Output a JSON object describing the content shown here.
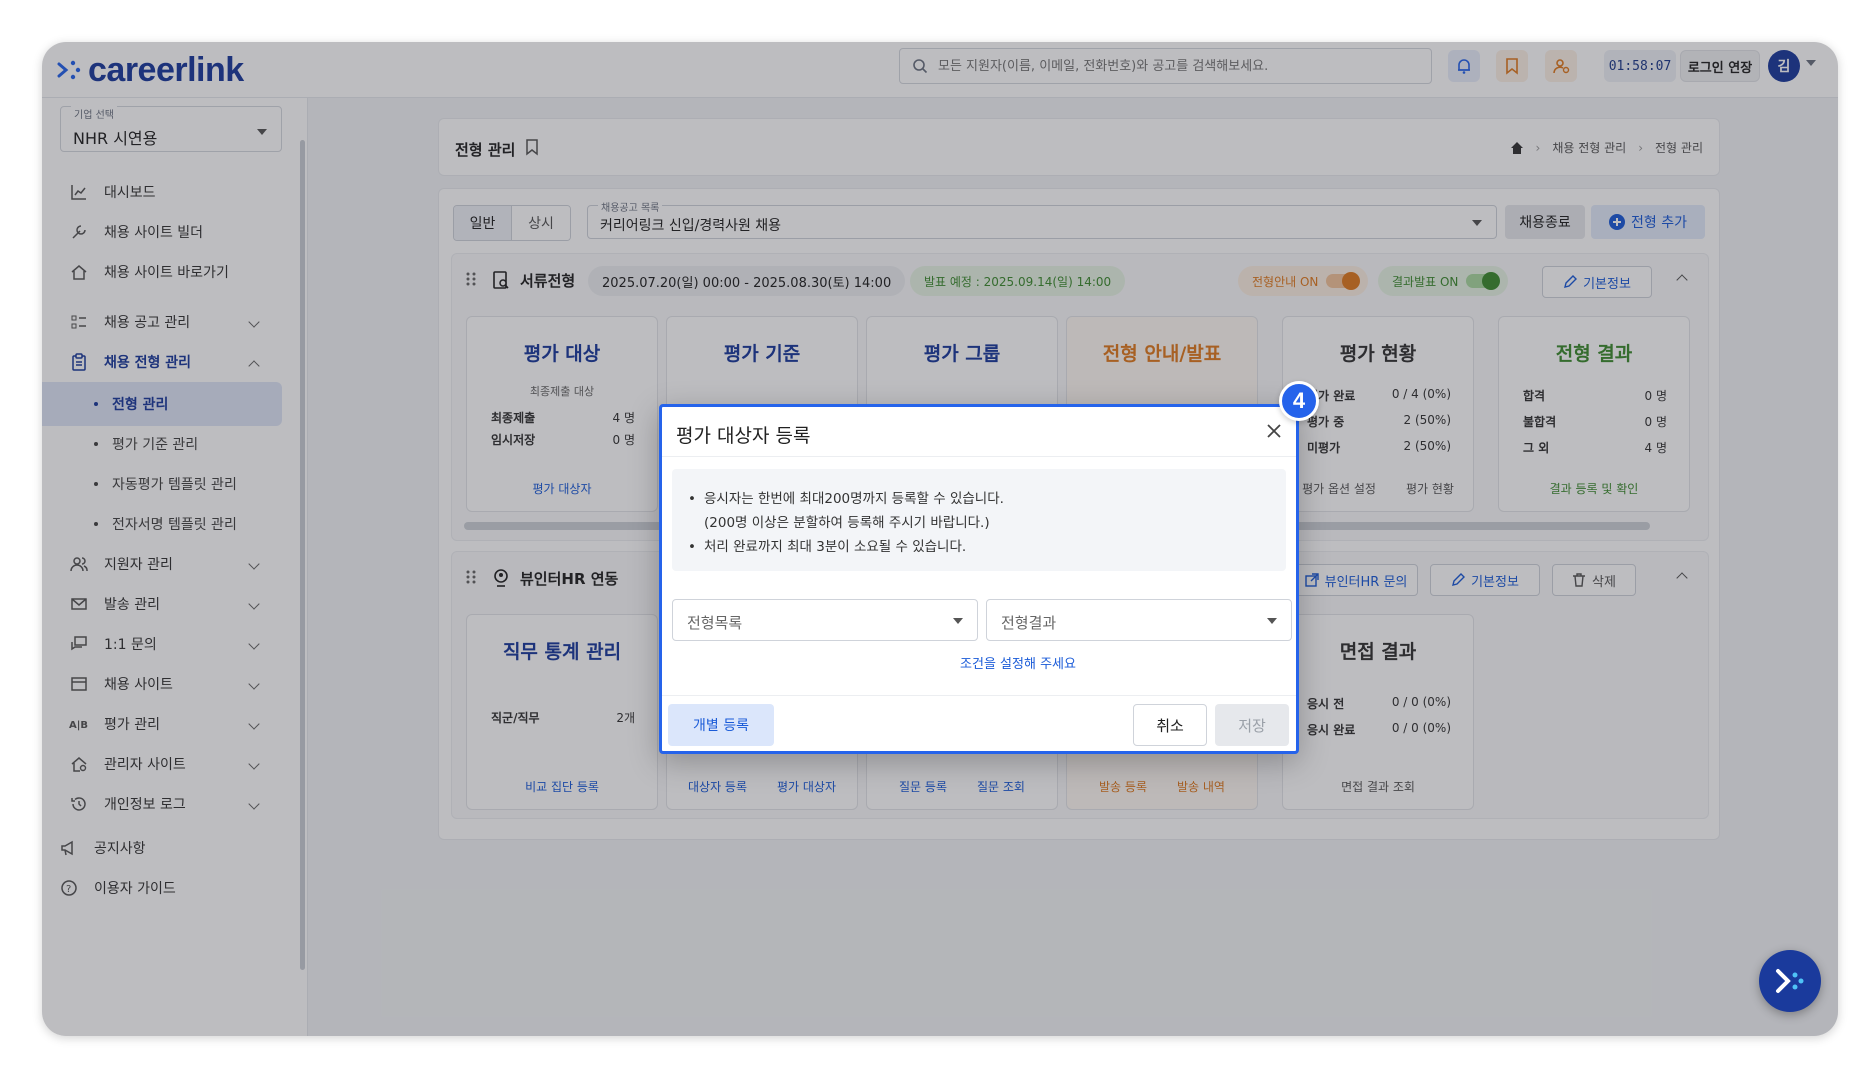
{
  "app": {
    "logo_text": "careerlink",
    "brand_color": "#1a3a9c",
    "accent": "#2563eb"
  },
  "topbar": {
    "search_placeholder": "모든 지원자(이름, 이메일, 전화번호)와 공고를 검색해보세요.",
    "timer": "01:58:07",
    "extend_label": "로그인 연장",
    "avatar_initial": "김",
    "icons": [
      "bell-icon",
      "bookmark-icon",
      "user-org-icon"
    ]
  },
  "sidebar": {
    "company_label": "기업 선택",
    "company_value": "NHR 시연용",
    "items": [
      {
        "label": "대시보드",
        "icon": "chart-icon"
      },
      {
        "label": "채용 사이트 빌더",
        "icon": "wrench-icon"
      },
      {
        "label": "채용 사이트 바로가기",
        "icon": "home-link-icon"
      },
      {
        "label": "채용 공고 관리",
        "icon": "list-icon"
      },
      {
        "label": "채용 전형 관리",
        "icon": "clipboard-icon"
      }
    ],
    "sub_items": [
      "전형 관리",
      "평가 기준 관리",
      "자동평가 템플릿 관리",
      "전자서명 템플릿 관리"
    ],
    "items2": [
      {
        "label": "지원자 관리",
        "icon": "users-icon"
      },
      {
        "label": "발송 관리",
        "icon": "mail-icon"
      },
      {
        "label": "1:1 문의",
        "icon": "chat-icon"
      },
      {
        "label": "채용 사이트",
        "icon": "window-icon"
      },
      {
        "label": "평가 관리",
        "icon": "ab-icon"
      },
      {
        "label": "관리자 사이트",
        "icon": "admin-home-icon"
      },
      {
        "label": "개인정보 로그",
        "icon": "history-icon"
      }
    ],
    "footer": [
      {
        "label": "공지사항",
        "icon": "megaphone-icon"
      },
      {
        "label": "이용자 가이드",
        "icon": "help-icon"
      }
    ]
  },
  "header": {
    "title": "전형 관리",
    "breadcrumb": [
      "채용 전형 관리",
      "전형 관리"
    ]
  },
  "toolbar": {
    "seg": [
      "일반",
      "상시"
    ],
    "job_label": "채용공고 목록",
    "job_value": "커리어링크 신입/경력사원 채용",
    "end_label": "채용종료",
    "add_label": "전형 추가"
  },
  "stage1": {
    "name": "서류전형",
    "period": "2025.07.20(일) 00:00 - 2025.08.30(토) 14:00",
    "announce": "발표 예정 : 2025.09.14(일) 14:00",
    "toggle1": "전형안내 ON",
    "toggle2": "결과발표 ON",
    "info_label": "기본정보",
    "cards": {
      "target": {
        "title": "평가 대상",
        "sub": "최종제출 대상",
        "r1k": "최종제출",
        "r1v": "4 명",
        "r2k": "임시저장",
        "r2v": "0 명",
        "link": "평가 대상자"
      },
      "criteria": {
        "title": "평가 기준"
      },
      "group": {
        "title": "평가 그룹"
      },
      "notice": {
        "title": "전형 안내/발표"
      },
      "status": {
        "title": "평가 현황",
        "r1k": "평가 완료",
        "r1v": "0 / 4 (0%)",
        "r2k": "평가 중",
        "r2v": "2 (50%)",
        "r3k": "미평가",
        "r3v": "2 (50%)",
        "link1": "평가 옵션 설정",
        "link2": "평가 현황"
      },
      "result": {
        "title": "전형 결과",
        "r1k": "합격",
        "r1v": "0 명",
        "r2k": "불합격",
        "r2v": "0 명",
        "r3k": "그 외",
        "r3v": "4 명",
        "link": "결과 등록 및 확인"
      }
    }
  },
  "stage2": {
    "name": "뷰인터HR 연동",
    "btn_inquiry": "뷰인터HR 문의",
    "info_label": "기본정보",
    "delete_label": "삭제",
    "cards": {
      "stats": {
        "title": "직무 통계 관리",
        "r1k": "직군/직무",
        "r1v": "2개",
        "link": "비교 집단 등록"
      },
      "c2": {
        "link1": "대상자 등록",
        "link2": "평가 대상자"
      },
      "c3": {
        "link1": "질문 등록",
        "link2": "질문 조회"
      },
      "c4": {
        "link1": "발송 등록",
        "link2": "발송 내역"
      },
      "interview": {
        "title": "면접 결과",
        "r1k": "응시 전",
        "r1v": "0 / 0 (0%)",
        "r2k": "응시 완료",
        "r2v": "0 / 0 (0%)",
        "link": "면접 결과 조회"
      }
    }
  },
  "modal": {
    "title": "평가 대상자 등록",
    "bullet1": "응시자는 한번에 최대200명까지 등록할 수 있습니다.",
    "bullet1_cont": "(200명 이상은 분할하여 등록해 주시기 바랍니다.)",
    "bullet2": "처리 완료까지 최대 3분이 소요될 수 있습니다.",
    "select1": "전형목록",
    "select2": "전형결과",
    "hint": "조건을 설정해 주세요",
    "btn_individual": "개별 등록",
    "btn_cancel": "취소",
    "btn_save": "저장",
    "step": "4"
  }
}
